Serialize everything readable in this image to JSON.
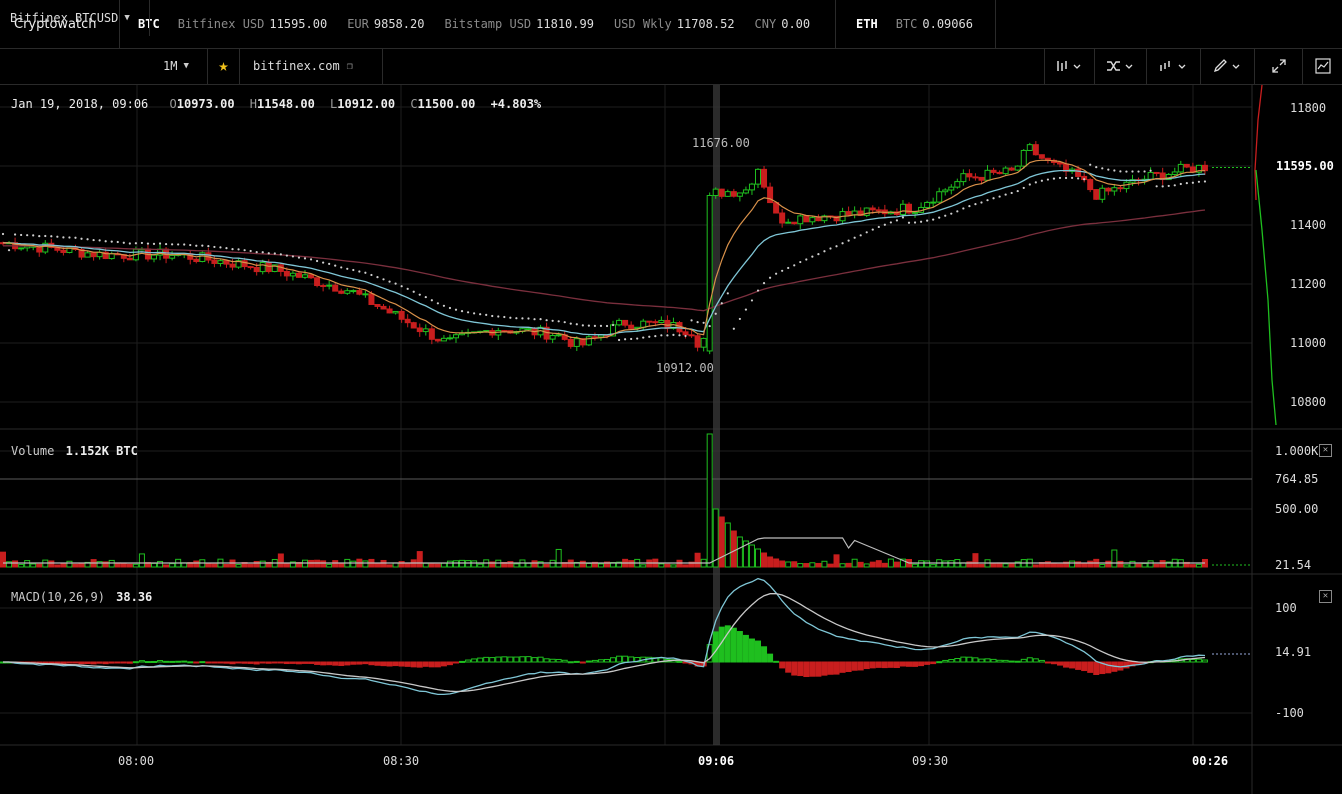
{
  "topbar": {
    "brand": "Cryptowatch",
    "btc": {
      "label": "BTC",
      "items": [
        {
          "label": "Bitfinex USD",
          "value": "11595.00"
        },
        {
          "label": "EUR",
          "value": "9858.20"
        },
        {
          "label": "Bitstamp USD",
          "value": "11810.99"
        },
        {
          "label": "USD Wkly",
          "value": "11708.52"
        },
        {
          "label": "CNY",
          "value": "0.00"
        }
      ]
    },
    "eth": {
      "label": "ETH",
      "items": [
        {
          "label": "BTC",
          "value": "0.09066"
        }
      ]
    }
  },
  "toolbar": {
    "market": "Bitfinex BTCUSD",
    "period": "1M",
    "site": "bitfinex.com"
  },
  "ohlc": {
    "date": "Jan 19, 2018, 09:06",
    "o_key": "O",
    "o": "10973.00",
    "h_key": "H",
    "h": "11548.00",
    "l_key": "L",
    "l": "10912.00",
    "c_key": "C",
    "c": "11500.00",
    "change": "+4.803%"
  },
  "price_axis": {
    "ticks": [
      "11800",
      "11600",
      "11400",
      "11200",
      "11000",
      "10800"
    ],
    "tick_values": [
      11800,
      11600,
      11400,
      11200,
      11000,
      10800
    ],
    "current": "11595.00",
    "high_note": "11676.00",
    "low_note": "10912.00"
  },
  "volume": {
    "label": "Volume",
    "value": "1.152K BTC",
    "ticks": [
      "1.000K",
      "764.85",
      "500.00",
      "21.54"
    ]
  },
  "macd": {
    "label": "MACD(10,26,9)",
    "value": "38.36",
    "ticks": [
      "100",
      "14.91",
      "-100"
    ]
  },
  "time_axis": {
    "labels": [
      "08:00",
      "08:30",
      "09:06",
      "09:30",
      "00:26"
    ]
  },
  "colors": {
    "up": "#1fbf1f",
    "down": "#c81e1e",
    "ema_fast": "#d9914a",
    "ema_slow": "#7fc6d6",
    "ema_long": "#7a2f3d",
    "grid": "#1e1e1e",
    "star": "#f2c31b"
  }
}
